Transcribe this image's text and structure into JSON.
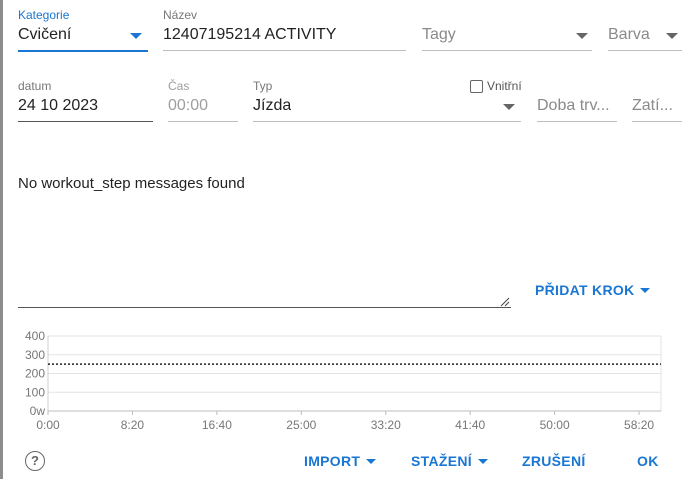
{
  "form": {
    "kategorie": {
      "label": "Kategorie",
      "value": "Cvičení"
    },
    "nazev": {
      "label": "Název",
      "value": "12407195214 ACTIVITY"
    },
    "tagy": {
      "placeholder": "Tagy"
    },
    "barva": {
      "placeholder": "Barva"
    },
    "datum": {
      "label": "datum",
      "value": "24 10 2023"
    },
    "cas": {
      "label": "Čas",
      "value": "00:00"
    },
    "typ": {
      "label": "Typ",
      "value": "Jízda"
    },
    "vnitrni": {
      "label": "Vnitřní",
      "checked": false
    },
    "doba": {
      "placeholder": "Doba trv..."
    },
    "zatizeni": {
      "placeholder": "Zatí..."
    }
  },
  "steps": {
    "empty_message": "No workout_step messages found",
    "add_step_label": "PŘIDAT KROK"
  },
  "chart_data": {
    "type": "line",
    "y_ticks": [
      "400",
      "300",
      "200",
      "100",
      "0w"
    ],
    "x_ticks": [
      "0:00",
      "8:20",
      "16:40",
      "25:00",
      "33:20",
      "41:40",
      "50:00",
      "58:20"
    ],
    "ylim": [
      0,
      400
    ],
    "grid": true,
    "series": [
      {
        "style": "dotted",
        "values": [
          [
            0,
            250
          ],
          [
            60.5,
            250
          ]
        ]
      }
    ]
  },
  "footer": {
    "import_label": "IMPORT",
    "download_label": "STAŽENÍ",
    "cancel_label": "ZRUŠENÍ",
    "ok_label": "OK"
  },
  "icons": {
    "help": "help-circle-icon",
    "dropdown": "chevron-down-icon"
  }
}
